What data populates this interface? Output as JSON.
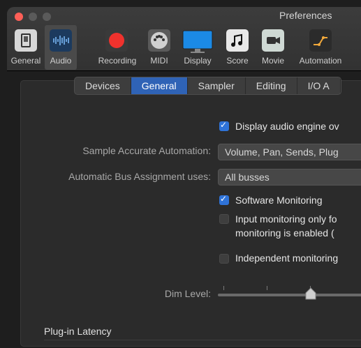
{
  "window": {
    "title": "Preferences"
  },
  "toolbar": {
    "items": [
      {
        "label": "General",
        "icon": "general-switch-icon"
      },
      {
        "label": "Audio",
        "icon": "audio-waveform-icon",
        "active": true
      },
      {
        "label": "Recording",
        "icon": "record-icon"
      },
      {
        "label": "MIDI",
        "icon": "midi-connector-icon"
      },
      {
        "label": "Display",
        "icon": "display-monitor-icon"
      },
      {
        "label": "Score",
        "icon": "score-note-icon"
      },
      {
        "label": "Movie",
        "icon": "movie-camera-icon"
      },
      {
        "label": "Automation",
        "icon": "automation-curve-icon"
      }
    ]
  },
  "tabs": [
    {
      "label": "Devices"
    },
    {
      "label": "General",
      "active": true
    },
    {
      "label": "Sampler"
    },
    {
      "label": "Editing"
    },
    {
      "label": "I/O A"
    }
  ],
  "settings": {
    "display_audio_engine": {
      "label": "Display audio engine ov",
      "checked": true
    },
    "sample_accurate_automation": {
      "label": "Sample Accurate Automation:",
      "value": "Volume, Pan, Sends, Plug"
    },
    "automatic_bus_assignment": {
      "label": "Automatic Bus Assignment uses:",
      "value": "All busses"
    },
    "software_monitoring": {
      "label": "Software Monitoring",
      "checked": true
    },
    "input_monitoring": {
      "line1": "Input monitoring only fo",
      "line2": "monitoring is enabled (",
      "checked": false
    },
    "independent_monitoring": {
      "label": "Independent monitoring",
      "checked": false
    },
    "dim_level": {
      "label": "Dim Level:"
    }
  },
  "plugin_latency": {
    "title": "Plug-in Latency"
  },
  "colors": {
    "accent": "#2f63b6",
    "checkbox": "#2f73d8",
    "close": "#fe5f57"
  }
}
